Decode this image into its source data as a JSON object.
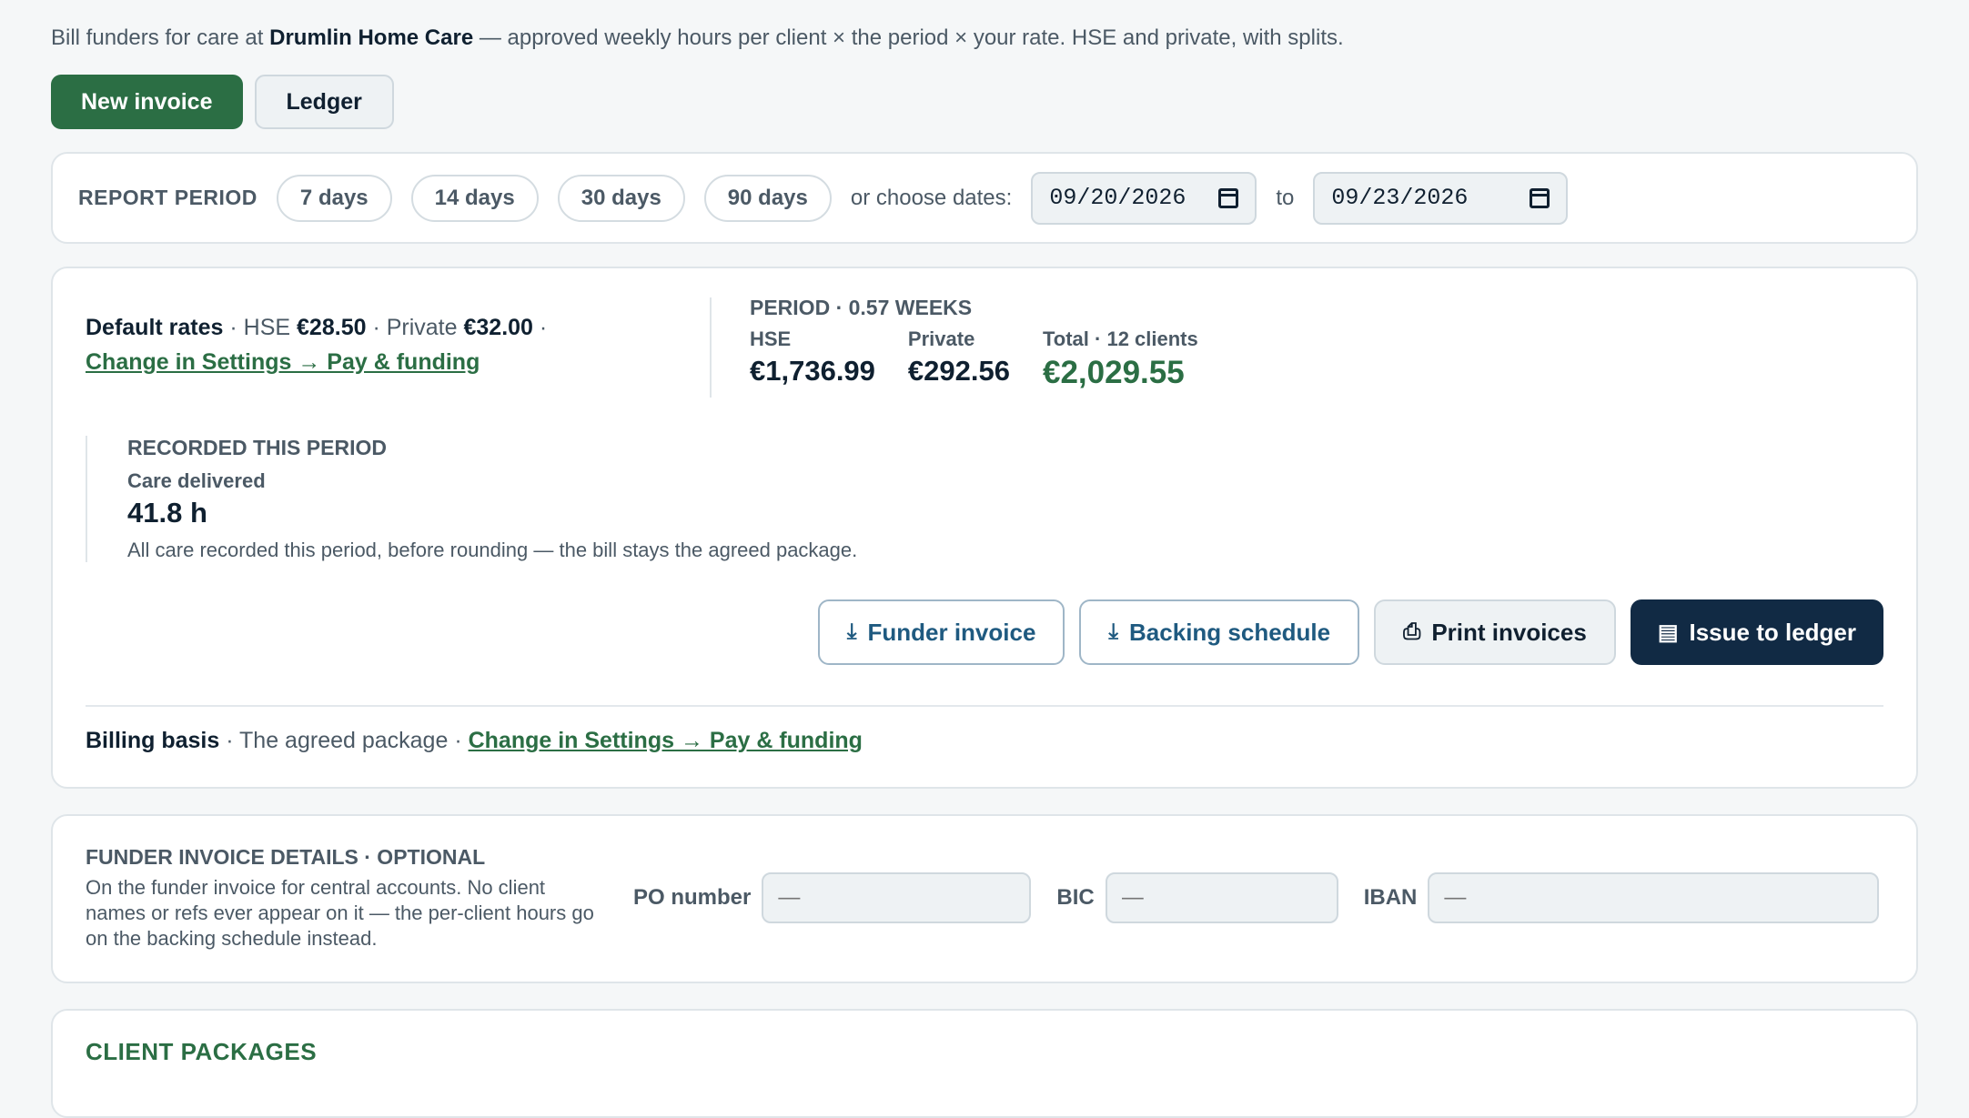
{
  "intro": {
    "prefix": "Bill funders for care at ",
    "company": "Drumlin Home Care",
    "suffix": " — approved weekly hours per client × the period × your rate. HSE and private, with splits."
  },
  "toolbar": {
    "new_invoice": "New invoice",
    "ledger": "Ledger"
  },
  "report_period": {
    "label": "REPORT PERIOD",
    "presets": [
      "7 days",
      "14 days",
      "30 days",
      "90 days"
    ],
    "or_label": "or choose dates:",
    "from": "09/20/2026",
    "to_label": "to",
    "to": "09/23/2026"
  },
  "rates": {
    "label": "Default rates",
    "hse_label": "HSE",
    "hse": "€28.50",
    "private_label": "Private",
    "private": "€32.00",
    "link": "Change in Settings → Pay & funding"
  },
  "period": {
    "title": "PERIOD · 0.57 WEEKS",
    "hse_label": "HSE",
    "hse": "€1,736.99",
    "private_label": "Private",
    "private": "€292.56",
    "total_label": "Total · 12 clients",
    "total": "€2,029.55"
  },
  "recorded": {
    "title": "RECORDED THIS PERIOD",
    "sub": "Care delivered",
    "value": "41.8 h",
    "note": "All care recorded this period, before rounding — the bill stays the agreed package."
  },
  "actions": {
    "funder_invoice": "Funder invoice",
    "backing_schedule": "Backing schedule",
    "print_invoices": "Print invoices",
    "issue_to_ledger": "Issue to ledger"
  },
  "billing": {
    "label": "Billing basis",
    "value": "The agreed package",
    "link": "Change in Settings → Pay & funding"
  },
  "funder": {
    "title": "FUNDER INVOICE DETAILS · OPTIONAL",
    "text": "On the funder invoice for central accounts. No client names or refs ever appear on it — the per-client hours go on the backing schedule instead.",
    "po_label": "PO number",
    "po_placeholder": "—",
    "bic_label": "BIC",
    "bic_placeholder": "—",
    "iban_label": "IBAN",
    "iban_placeholder": "—"
  },
  "client_packages": {
    "title": "CLIENT PACKAGES"
  }
}
